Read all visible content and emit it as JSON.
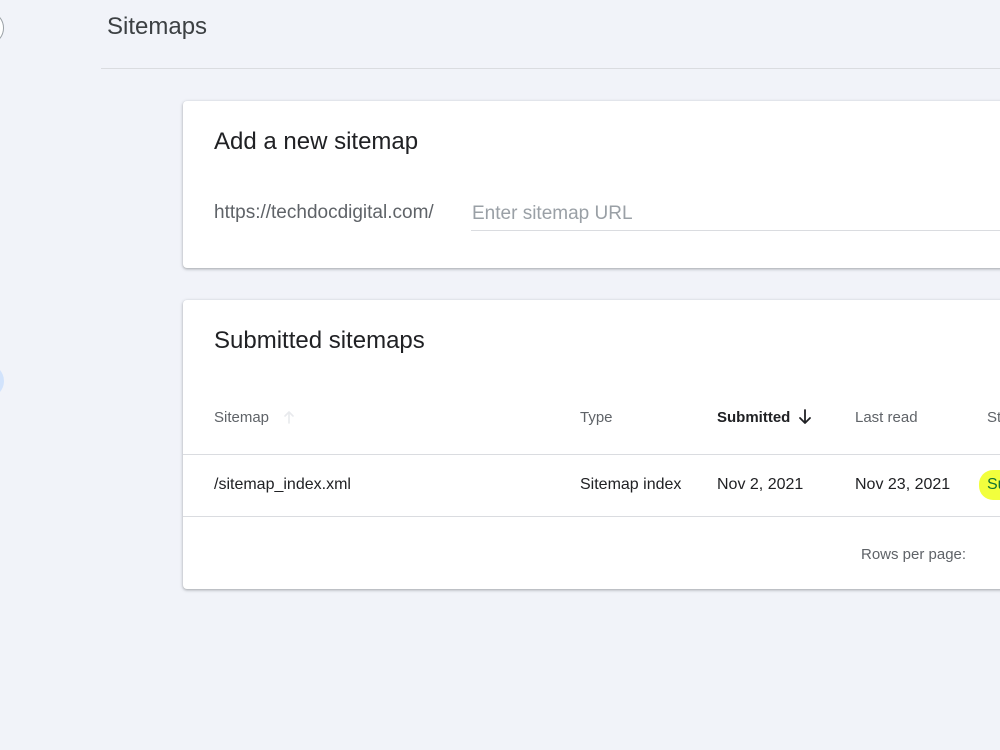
{
  "header": {
    "title": "Sitemaps"
  },
  "add_sitemap": {
    "title": "Add a new sitemap",
    "url_prefix": "https://techdocdigital.com/",
    "input_placeholder": "Enter sitemap URL",
    "input_value": ""
  },
  "submitted": {
    "title": "Submitted sitemaps",
    "columns": {
      "sitemap": "Sitemap",
      "type": "Type",
      "submitted": "Submitted",
      "last_read": "Last read",
      "status": "St"
    },
    "sort": {
      "active_column": "Submitted",
      "direction": "descending"
    },
    "rows": [
      {
        "sitemap": "/sitemap_index.xml",
        "type": "Sitemap index",
        "submitted": "Nov 2, 2021",
        "last_read": "Nov 23, 2021",
        "status": "Su"
      }
    ],
    "footer": {
      "rows_per_page_label": "Rows per page:"
    }
  },
  "colors": {
    "page_background": "#f1f3f9",
    "card_background": "#ffffff",
    "status_success_text": "#137333",
    "status_highlight": "#f2ff3d"
  },
  "icons": {
    "sort_inactive": "arrow-up-icon",
    "sort_active": "arrow-down-icon"
  }
}
